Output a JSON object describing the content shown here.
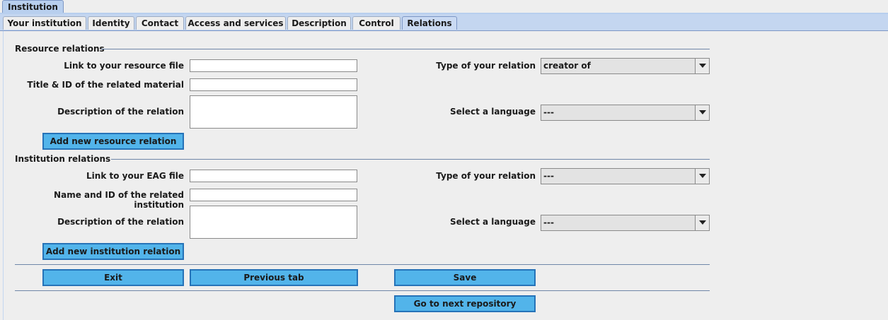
{
  "window": {
    "top_tab_label": "Institution"
  },
  "tabs": [
    {
      "label": "Your institution"
    },
    {
      "label": "Identity"
    },
    {
      "label": "Contact"
    },
    {
      "label": "Access and services"
    },
    {
      "label": "Description"
    },
    {
      "label": "Control"
    },
    {
      "label": "Relations",
      "active": true
    }
  ],
  "resource_relations": {
    "title": "Resource relations",
    "link_label": "Link to your resource file",
    "link_value": "",
    "title_id_label": "Title & ID of the related material",
    "title_id_value": "",
    "description_label": "Description of the relation",
    "description_value": "",
    "type_label": "Type of your relation",
    "type_value": "creator of",
    "language_label": "Select a language",
    "language_value": "---",
    "add_button": "Add new resource relation"
  },
  "institution_relations": {
    "title": "Institution relations",
    "link_label": "Link to your EAG file",
    "link_value": "",
    "name_id_label": "Name and ID of the related institution",
    "name_id_value": "",
    "description_label": "Description of the relation",
    "description_value": "",
    "type_label": "Type of your relation",
    "type_value": "---",
    "language_label": "Select a language",
    "language_value": "---",
    "add_button": "Add new institution relation"
  },
  "footer": {
    "exit_button": "Exit",
    "previous_button": "Previous tab",
    "save_button": "Save",
    "next_repository_button": "Go to next repository"
  },
  "colors": {
    "button_fill": "#52b4ea",
    "button_border": "#2673b8",
    "tabbar_bg": "#c4d6f0"
  }
}
